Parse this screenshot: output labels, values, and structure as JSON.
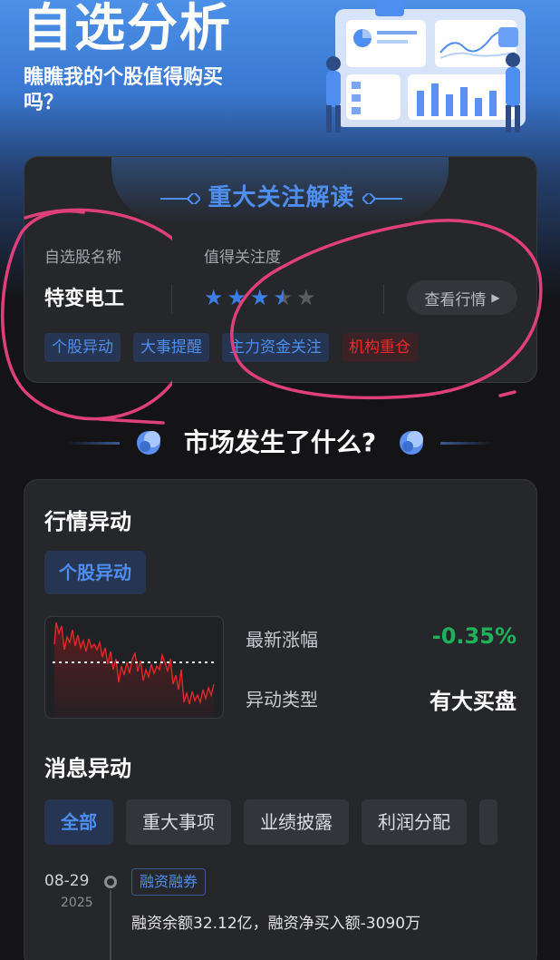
{
  "hero": {
    "title": "自选分析",
    "subtitle": "瞧瞧我的个股值得购买吗？"
  },
  "focus_card": {
    "header": "重大关注解读",
    "stock_label": "自选股名称",
    "stock_name": "特变电工",
    "attention_label": "值得关注度",
    "rating": 3.5,
    "rating_max": 5,
    "view_button": "查看行情",
    "tags": [
      {
        "label": "个股异动",
        "color": "blue"
      },
      {
        "label": "大事提醒",
        "color": "blue"
      },
      {
        "label": "主力资金关注",
        "color": "blue"
      },
      {
        "label": "机构重仓",
        "color": "red"
      }
    ]
  },
  "market_title": "市场发生了什么?",
  "quote_section": {
    "title": "行情异动",
    "chip": "个股异动",
    "latest_change_label": "最新涨幅",
    "latest_change_value": "-0.35%",
    "type_label": "异动类型",
    "type_value": "有大买盘"
  },
  "news_section": {
    "title": "消息异动",
    "filters": [
      "全部",
      "重大事项",
      "业绩披露",
      "利润分配"
    ],
    "active_filter": "全部",
    "items": [
      {
        "date": "08-29",
        "year": "2025",
        "tag": "融资融券",
        "text": "融资余额32.12亿，融资净买入额-3090万"
      }
    ]
  },
  "colors": {
    "accent_blue": "#4e8ef0",
    "negative_green": "#1fb25a",
    "alert_red": "#f0282e",
    "star_blue": "#3c7ee8",
    "annotation_pink": "#e0407a"
  }
}
